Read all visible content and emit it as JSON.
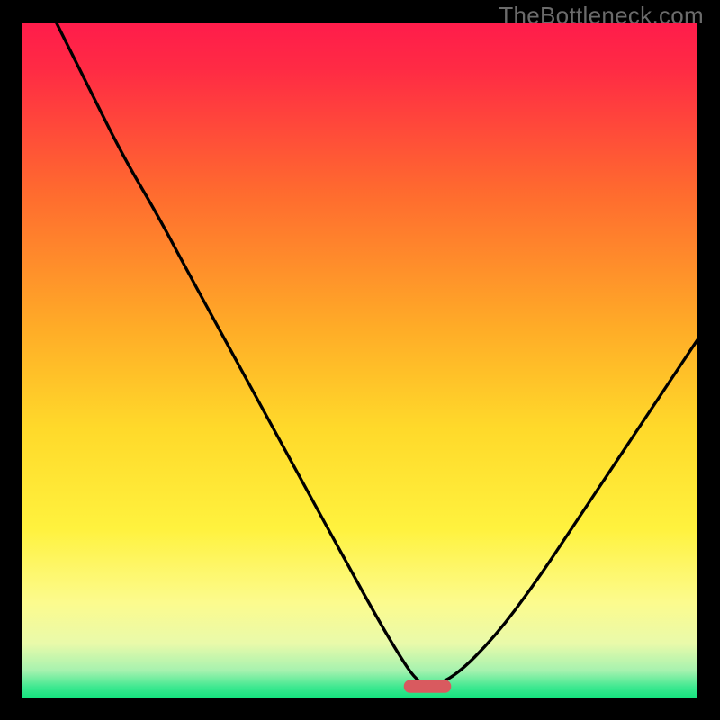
{
  "watermark": "TheBottleneck.com",
  "chart_data": {
    "type": "line",
    "title": "",
    "xlabel": "",
    "ylabel": "",
    "xlim": [
      0,
      100
    ],
    "ylim": [
      0,
      100
    ],
    "grid": false,
    "legend": false,
    "background_gradient": {
      "stops": [
        {
          "offset": 0.0,
          "color": "#ff1c4b"
        },
        {
          "offset": 0.07,
          "color": "#ff2b44"
        },
        {
          "offset": 0.25,
          "color": "#ff6a2f"
        },
        {
          "offset": 0.45,
          "color": "#ffab27"
        },
        {
          "offset": 0.6,
          "color": "#ffd92a"
        },
        {
          "offset": 0.75,
          "color": "#fff23e"
        },
        {
          "offset": 0.86,
          "color": "#fcfb8e"
        },
        {
          "offset": 0.92,
          "color": "#e9faaa"
        },
        {
          "offset": 0.96,
          "color": "#a6f2af"
        },
        {
          "offset": 0.985,
          "color": "#3de890"
        },
        {
          "offset": 1.0,
          "color": "#16e37f"
        }
      ]
    },
    "series": [
      {
        "name": "bottleneck-curve",
        "x": [
          5,
          10,
          15,
          20,
          24,
          30,
          36,
          42,
          48,
          53,
          56,
          58,
          60,
          64,
          70,
          76,
          82,
          88,
          94,
          100
        ],
        "y": [
          100,
          90,
          80,
          71.5,
          64,
          53,
          42,
          31,
          20,
          11,
          6,
          3,
          1.5,
          3,
          9,
          17,
          26,
          35,
          44,
          53
        ]
      }
    ],
    "marker": {
      "name": "optimal-range",
      "x_center": 60,
      "width": 7,
      "color": "#d95a5f"
    }
  }
}
